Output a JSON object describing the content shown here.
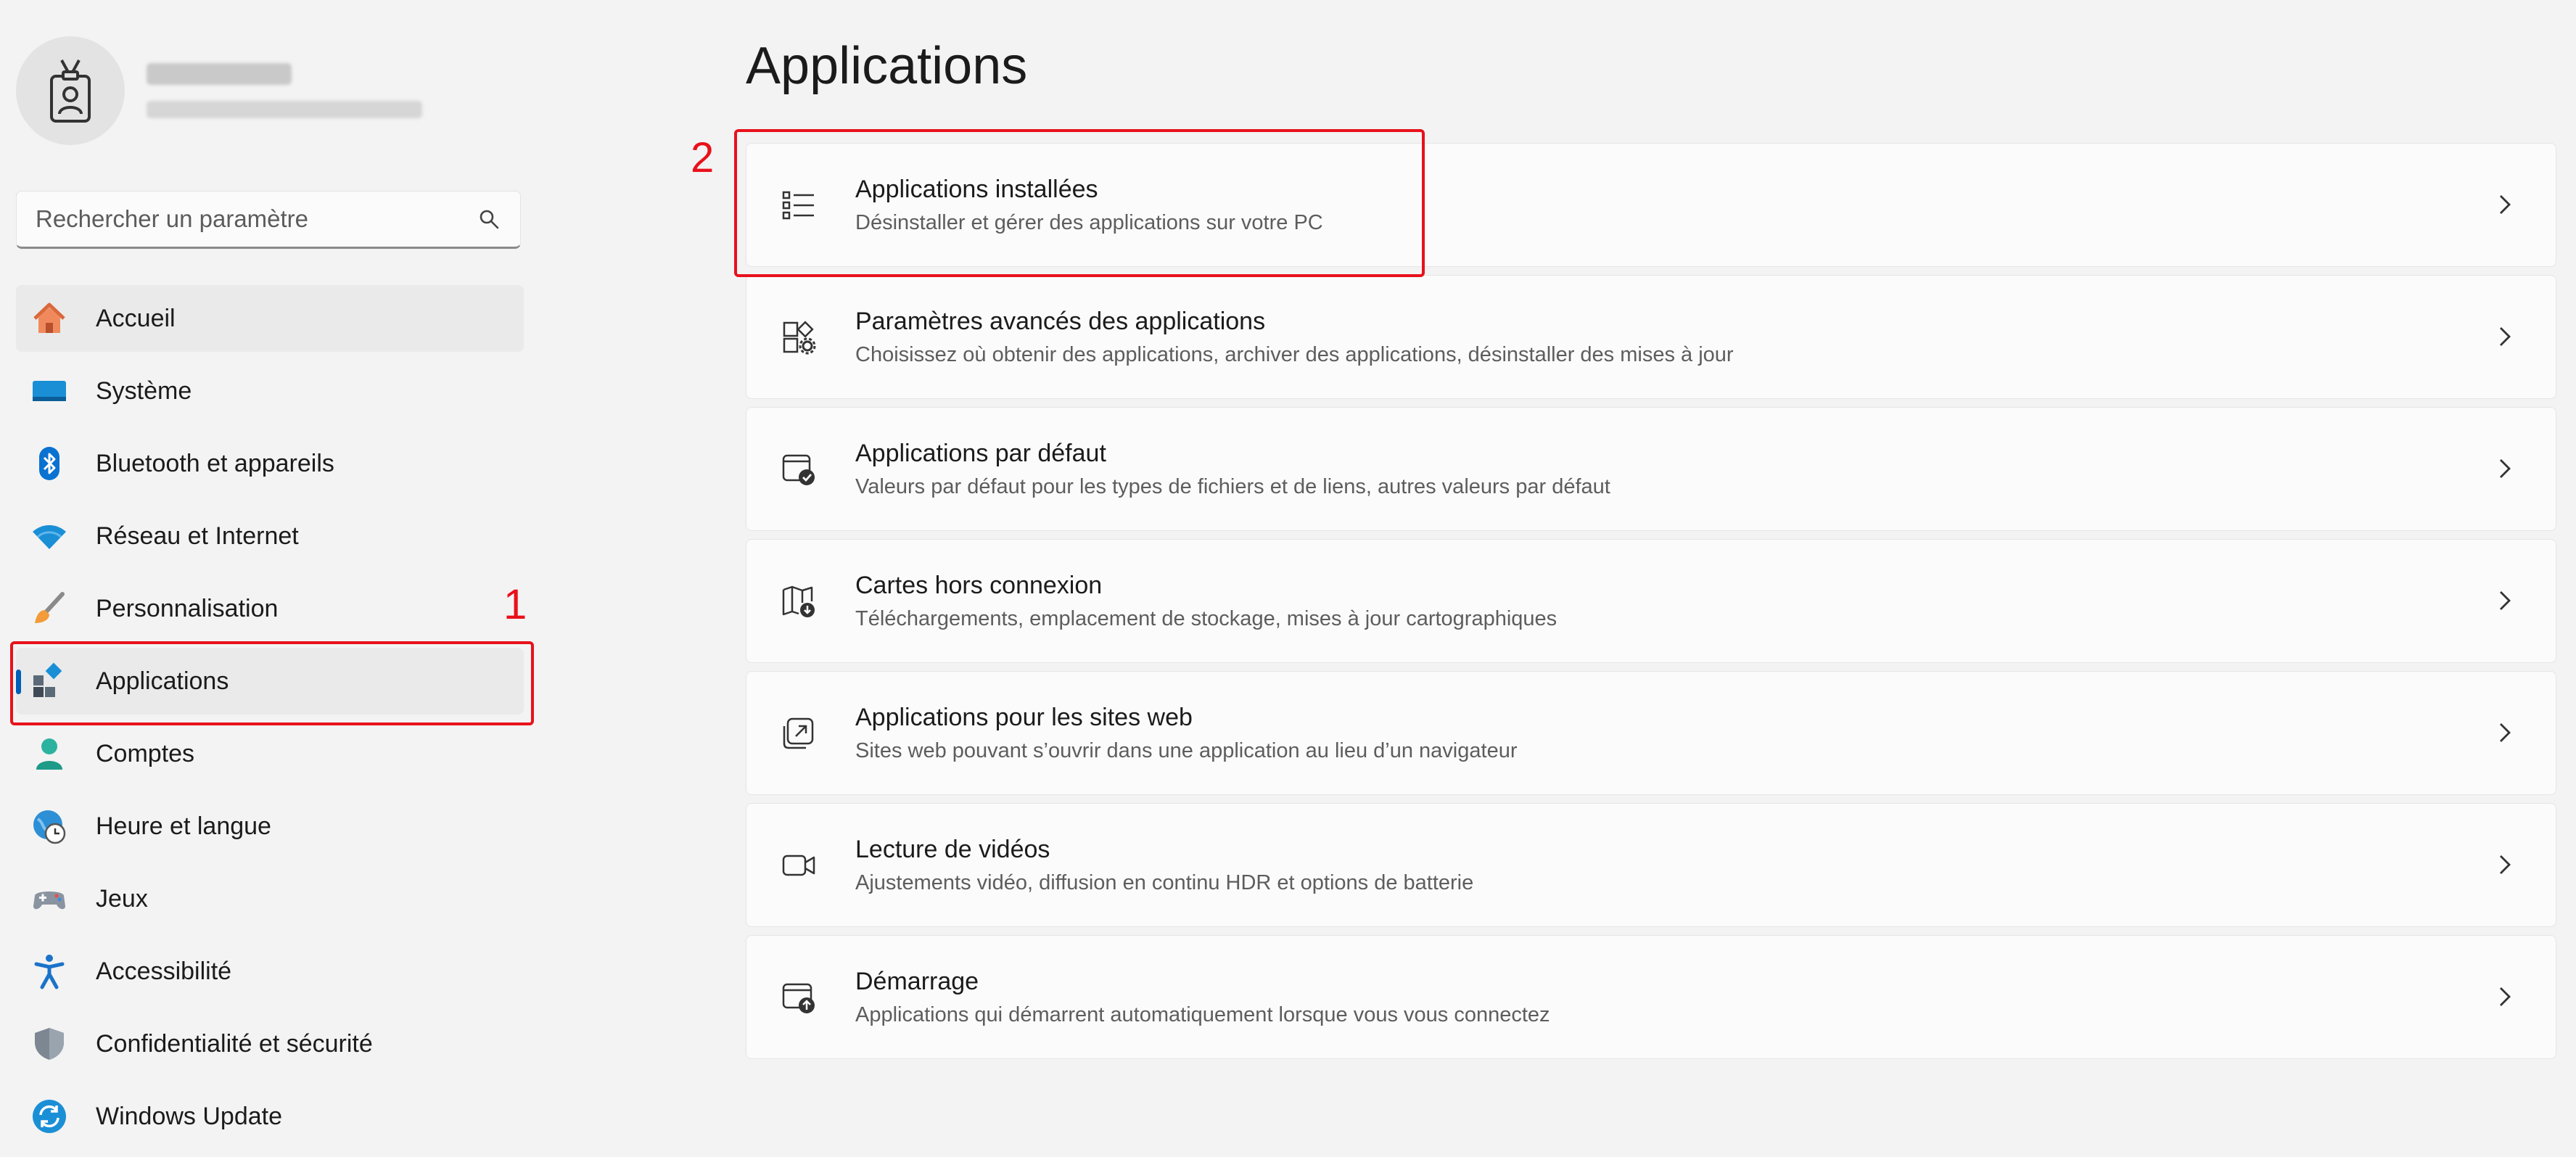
{
  "sidebar": {
    "search": {
      "placeholder": "Rechercher un paramètre"
    },
    "items": [
      {
        "label": "Accueil",
        "icon": "home-icon"
      },
      {
        "label": "Système",
        "icon": "system-icon"
      },
      {
        "label": "Bluetooth et appareils",
        "icon": "bluetooth-icon"
      },
      {
        "label": "Réseau et Internet",
        "icon": "wifi-icon"
      },
      {
        "label": "Personnalisation",
        "icon": "brush-icon"
      },
      {
        "label": "Applications",
        "icon": "apps-icon"
      },
      {
        "label": "Comptes",
        "icon": "account-icon"
      },
      {
        "label": "Heure et langue",
        "icon": "clock-globe-icon"
      },
      {
        "label": "Jeux",
        "icon": "gamepad-icon"
      },
      {
        "label": "Accessibilité",
        "icon": "accessibility-icon"
      },
      {
        "label": "Confidentialité et sécurité",
        "icon": "shield-icon"
      },
      {
        "label": "Windows Update",
        "icon": "update-icon"
      }
    ],
    "selected": "Applications"
  },
  "annotations": {
    "callout_1": "1",
    "callout_2": "2"
  },
  "main": {
    "title": "Applications",
    "cards": [
      {
        "title": "Applications installées",
        "desc": "Désinstaller et gérer des applications sur votre PC",
        "icon": "list-icon"
      },
      {
        "title": "Paramètres avancés des applications",
        "desc": "Choisissez où obtenir des applications, archiver des applications, désinstaller des mises à jour",
        "icon": "app-settings-icon"
      },
      {
        "title": "Applications par défaut",
        "desc": "Valeurs par défaut pour les types de fichiers et de liens, autres valeurs par défaut",
        "icon": "default-apps-icon"
      },
      {
        "title": "Cartes hors connexion",
        "desc": "Téléchargements, emplacement de stockage, mises à jour cartographiques",
        "icon": "offline-map-icon"
      },
      {
        "title": "Applications pour les sites web",
        "desc": "Sites web pouvant s’ouvrir dans une application au lieu d’un navigateur",
        "icon": "open-external-icon"
      },
      {
        "title": "Lecture de vidéos",
        "desc": "Ajustements vidéo, diffusion en continu HDR et options de batterie",
        "icon": "video-camera-icon"
      },
      {
        "title": "Démarrage",
        "desc": "Applications qui démarrent automatiquement lorsque vous vous connectez",
        "icon": "startup-icon"
      }
    ]
  },
  "colors": {
    "accent": "#005fb8",
    "callout": "#e8111b",
    "background": "#f3f3f3",
    "card": "#fbfbfb"
  }
}
